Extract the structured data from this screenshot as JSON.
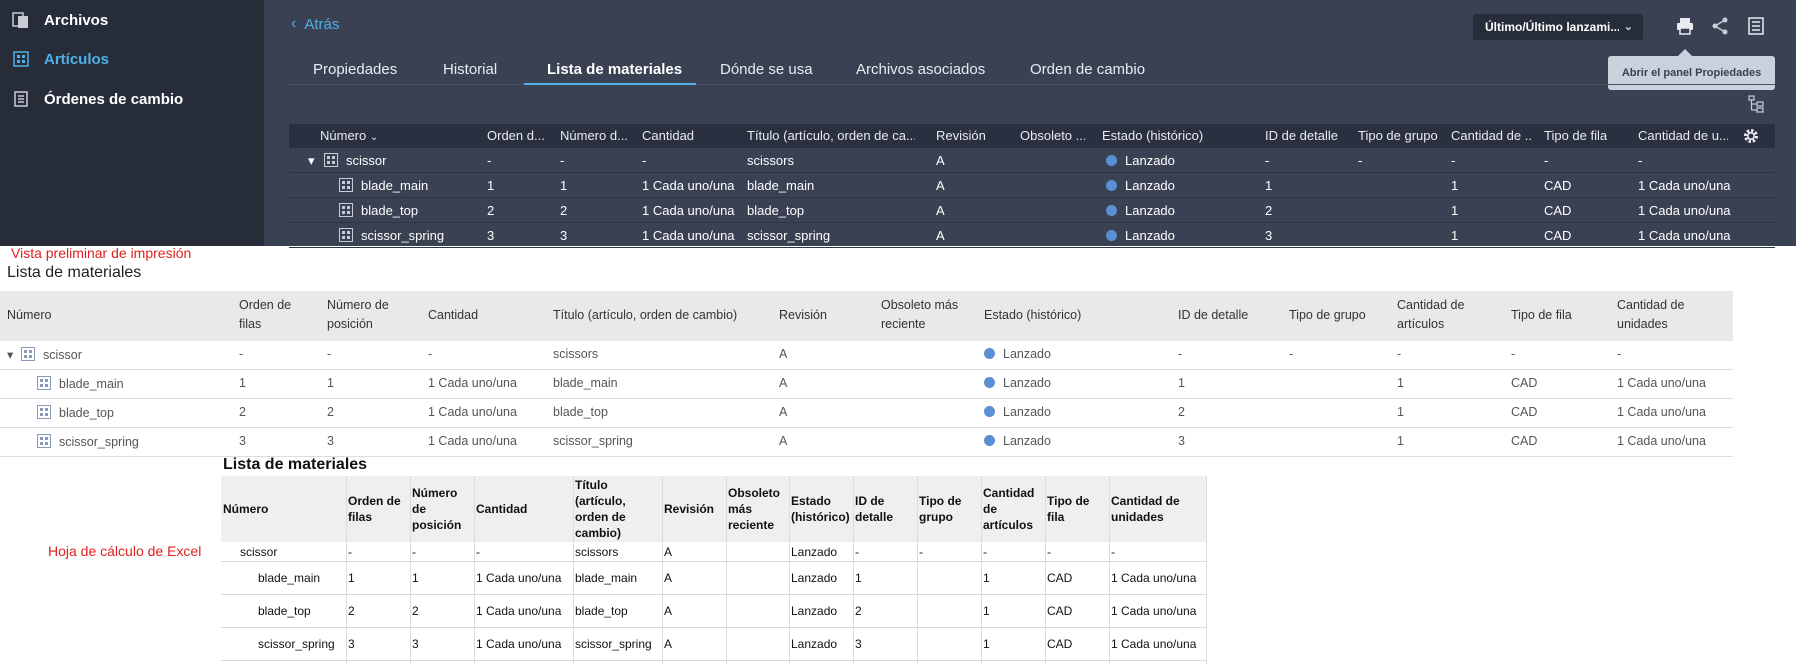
{
  "sidebar": {
    "items": [
      {
        "label": "Archivos",
        "icon": "files-icon"
      },
      {
        "label": "Artículos",
        "icon": "items-icon"
      },
      {
        "label": "Órdenes de cambio",
        "icon": "change-orders-icon"
      }
    ]
  },
  "header": {
    "back_label": "Atrás",
    "release_select": "Último/Último lanzami...",
    "tooltip": "Abrir el panel Propiedades"
  },
  "tabs": [
    {
      "label": "Propiedades"
    },
    {
      "label": "Historial"
    },
    {
      "label": "Lista de materiales",
      "active": true
    },
    {
      "label": "Dónde se usa"
    },
    {
      "label": "Archivos asociados"
    },
    {
      "label": "Orden de cambio"
    }
  ],
  "bom_table": {
    "headers": [
      "Número",
      "Orden d...",
      "Número d...",
      "Cantidad",
      "Título (artículo, orden de ca...",
      "Revisión",
      "Obsoleto ...",
      "Estado (histórico)",
      "ID de detalle",
      "Tipo de grupo",
      "Cantidad de ...",
      "Tipo de fila",
      "Cantidad de u..."
    ],
    "rows": [
      {
        "number": "scissor",
        "order": "-",
        "pos": "-",
        "qty": "-",
        "title": "scissors",
        "rev": "A",
        "obs": "",
        "state": "Lanzado",
        "detail": "-",
        "group": "-",
        "items_qty": "-",
        "row_type": "-",
        "units_qty": "-"
      },
      {
        "number": "blade_main",
        "order": "1",
        "pos": "1",
        "qty": "1 Cada uno/una",
        "title": "blade_main",
        "rev": "A",
        "obs": "",
        "state": "Lanzado",
        "detail": "1",
        "group": "",
        "items_qty": "1",
        "row_type": "CAD",
        "units_qty": "1 Cada uno/una"
      },
      {
        "number": "blade_top",
        "order": "2",
        "pos": "2",
        "qty": "1 Cada uno/una",
        "title": "blade_top",
        "rev": "A",
        "obs": "",
        "state": "Lanzado",
        "detail": "2",
        "group": "",
        "items_qty": "1",
        "row_type": "CAD",
        "units_qty": "1 Cada uno/una"
      },
      {
        "number": "scissor_spring",
        "order": "3",
        "pos": "3",
        "qty": "1 Cada uno/una",
        "title": "scissor_spring",
        "rev": "A",
        "obs": "",
        "state": "Lanzado",
        "detail": "3",
        "group": "",
        "items_qty": "1",
        "row_type": "CAD",
        "units_qty": "1 Cada uno/una"
      }
    ]
  },
  "print_preview": {
    "label": "Vista preliminar de impresión",
    "title": "Lista de materiales",
    "headers": [
      "Número",
      "Orden de filas",
      "Número de posición",
      "Cantidad",
      "Título (artículo, orden de cambio)",
      "Revisión",
      "Obsoleto más reciente",
      "Estado (histórico)",
      "ID de detalle",
      "Tipo de grupo",
      "Cantidad de artículos",
      "Tipo de fila",
      "Cantidad de unidades"
    ]
  },
  "excel": {
    "label": "Hoja de cálculo de Excel",
    "title": "Lista de materiales",
    "headers": [
      "Número",
      "Orden de filas",
      "Número de posición",
      "Cantidad",
      "Título (artículo, orden de cambio)",
      "Revisión",
      "Obsoleto más reciente",
      "Estado (histórico)",
      "ID de detalle",
      "Tipo de grupo",
      "Cantidad de artículos",
      "Tipo de fila",
      "Cantidad de unidades"
    ]
  },
  "colors": {
    "accent": "#4fb0e8",
    "status_dot": "#5b8fd3",
    "annotation": "#e02020"
  }
}
